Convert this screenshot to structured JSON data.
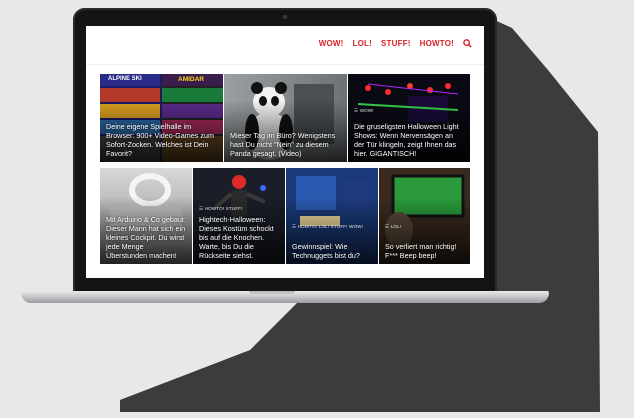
{
  "nav": {
    "links": [
      "WOW!",
      "LOL!",
      "STUFF!",
      "HOWTO!"
    ],
    "search_icon": "search-icon"
  },
  "colors": {
    "accent": "#d8232a",
    "background": "#e8e8e8",
    "shadow": "#3a3a3a"
  },
  "tiles": [
    {
      "category": "",
      "title": "Deine eigene Spielhalle im Browser: 900+ Video-Games zum Sofort-Zocken. Welches ist Dein Favorit?",
      "image_text": [
        "ALPINE SKI",
        "AMIDAR"
      ]
    },
    {
      "category": "",
      "title": "Mieser Tag im Büro? Wenigstens hast Du nicht \"Nein\" zu diesem Panda gesagt. (Video)"
    },
    {
      "category": "WOW!",
      "title": "Die gruseligsten Halloween Light Shows: Wenn Nervensägen an der Tür klingeln, zeigt Ihnen das hier. GIGANTISCH!"
    },
    {
      "category": "",
      "title": "Mit Arduino & Co gebaut: Dieser Mann hat sich ein kleines Cockpit. Du wirst jede Menge Überstunden machen!"
    },
    {
      "category": "HOWTO! STUFF!",
      "title": "Hightech-Halloween: Dieses Kostüm schockt bis auf die Knochen. Warte, bis Du die Rückseite siehst."
    },
    {
      "category": "HOWTO! LOL! STUFF! WOW!",
      "title": "Gewinnspiel: Wie Technuggets bist du?"
    },
    {
      "category": "LOL!",
      "title": "So verliert man richtig! F*** Beep beep!"
    }
  ]
}
